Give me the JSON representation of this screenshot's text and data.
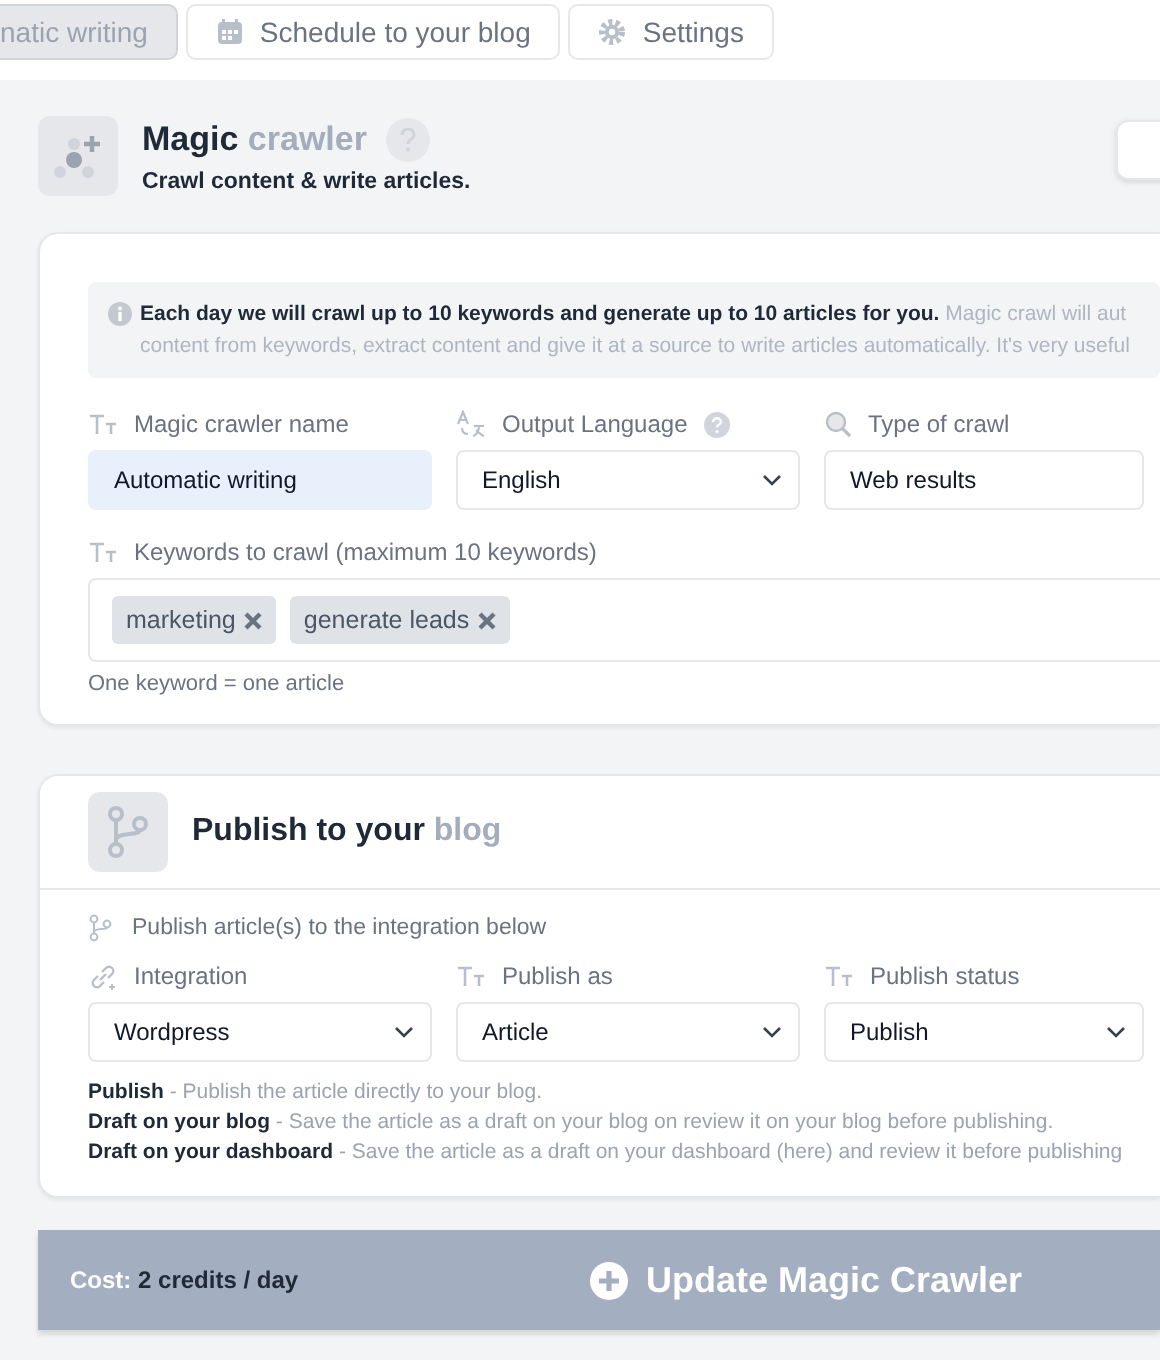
{
  "tabs": [
    {
      "label": "natic writing",
      "selected": true
    },
    {
      "label": "Schedule to your blog",
      "selected": false
    },
    {
      "label": "Settings",
      "selected": false
    }
  ],
  "header": {
    "title": "Magic",
    "title_muted": "crawler",
    "subtitle": "Crawl content & write articles."
  },
  "crawler": {
    "info_bold": "Each day we will crawl up to 10 keywords and generate up to 10 articles for you.",
    "info_text": "Magic crawl will aut content from keywords, extract content and give it at a source to write articles automatically. It's very useful",
    "fields": [
      {
        "label": "Magic crawler name",
        "kind": "input",
        "value": "Automatic writing",
        "focused": true
      },
      {
        "label": "Output Language",
        "kind": "select",
        "value": "English",
        "focused": false
      },
      {
        "label": "Type of crawl",
        "kind": "input",
        "value": "Web results",
        "focused": false
      }
    ],
    "keywords": {
      "label": "Keywords to crawl (maximum 10 keywords)",
      "tags": [
        "marketing",
        "generate leads"
      ],
      "hint": "One keyword = one article"
    }
  },
  "publish": {
    "title": "Publish to your",
    "title_muted": "blog",
    "note": "Publish article(s) to the integration below",
    "fields": [
      {
        "label": "Integration",
        "kind": "select",
        "value": "Wordpress"
      },
      {
        "label": "Publish as",
        "kind": "select",
        "value": "Article"
      },
      {
        "label": "Publish status",
        "kind": "select",
        "value": "Publish"
      }
    ],
    "descriptions": [
      {
        "term": "Publish",
        "text": "- Publish the article directly to your blog."
      },
      {
        "term": "Draft on your blog",
        "text": "- Save the article as a draft on your blog on review it on your blog before publishing."
      },
      {
        "term": "Draft on your dashboard",
        "text": "- Save the article as a draft on your dashboard (here) and review it before publishing"
      }
    ]
  },
  "footer": {
    "cost_label": "Cost:",
    "cost_value": "2 credits / day",
    "button": "Update Magic Crawler"
  }
}
